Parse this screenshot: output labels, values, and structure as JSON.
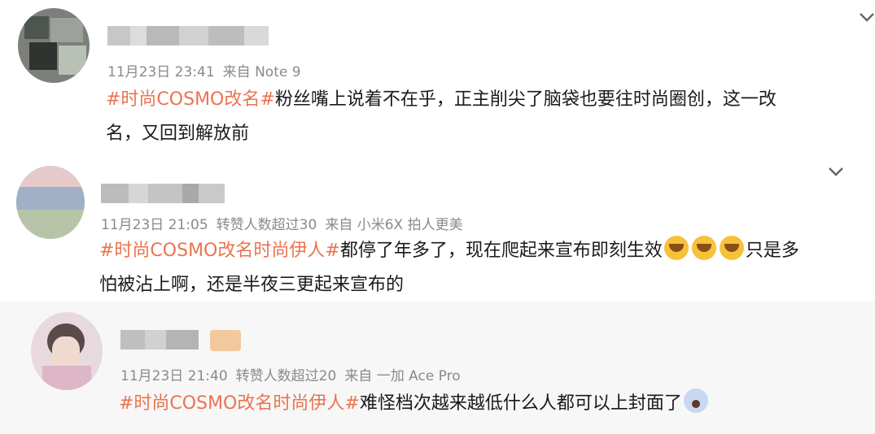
{
  "comments": [
    {
      "time": "11月23日 23:41",
      "source": "来自 Note 9",
      "tag": "#时尚COSMO改名#",
      "text_line1": "粉丝嘴上说着不在乎，正主削尖了脑袋也要往时尚圈创，这一改",
      "text_line2": "名，又回到解放前"
    },
    {
      "time": "11月23日 21:05",
      "reposts": "转赞人数超过30",
      "source": "来自 小米6X 拍人更美",
      "tag": "#时尚COSMO改名时尚伊人#",
      "text_line1": "都停了年多了，现在爬起来宣布即刻生效",
      "text_line1b": "只是多",
      "text_line2": "怕被沾上啊，还是半夜三更起来宣布的"
    },
    {
      "time": "11月23日 21:40",
      "reposts": "转赞人数超过20",
      "source": "来自 一加 Ace Pro",
      "tag": "#时尚COSMO改名时尚伊人#",
      "text_line1": "难怪档次越来越低什么人都可以上封面了"
    }
  ],
  "icons": {
    "expand": "chevron-down-icon",
    "emoji_laugh_cry": "laugh-cry-emoji-icon",
    "emoji_shock": "shocked-emoji-icon"
  },
  "colors": {
    "tag": "#eb7350",
    "meta": "#8a8a8a",
    "reply_background": "#f7f7f7"
  }
}
